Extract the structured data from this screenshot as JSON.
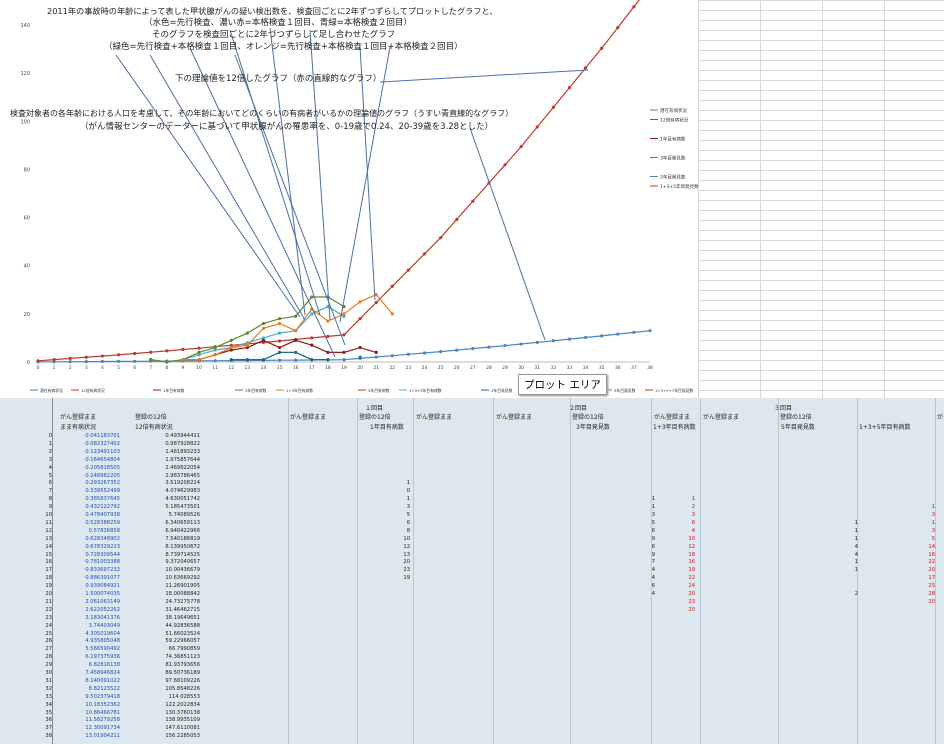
{
  "annotations": {
    "line1": "2011年の事故時の年齢によって表した甲状腺がんの疑い検出数を、検査回ごとに2年ずつずらしてプロットしたグラフと、",
    "line2": "（水色=先行検査、濃い赤=本格検査１回目、青緑=本格検査２回目）",
    "line3": "そのグラフを検査回ごとに2年づつずらして足し合わせたグラフ",
    "line4": "（緑色=先行検査+本格検査１回目、オレンジ=先行検査+本格検査１回目+本格検査２回目）",
    "line5": "下の理論値を12倍したグラフ（赤の直線的なグラフ）",
    "line6": "検査対象者の各年齢における人口を考慮して、その年齢においてどのくらいの有病者がいるかの理論値のグラフ（うすい青直線的なグラフ）",
    "line7": "（がん情報センターのデーターに基づいて甲状腺がんの罹患率を、0-19歳で0.24、20-39歳を3.28とした）"
  },
  "tooltip": "プロット エリア",
  "legend_right": [
    "潜在有病状況",
    "12倍有病状況",
    "",
    "1年目有病数",
    "",
    "3年目発見数",
    "",
    "5年目発見数",
    "1+3+5年目発見数"
  ],
  "legend_bottom": [
    "潜在有病状況",
    "12倍有病状況",
    "",
    "1年目有病数",
    "",
    "3年目有病数",
    "1+3年目有病数",
    "",
    "5年目有病数",
    "1+3+5年目有病数",
    "",
    "3年目発見数",
    "1+3+5+7年目発見数",
    "",
    "5年目発見数",
    "1+3+5+7年目発見数"
  ],
  "sheet": {
    "h1": "１回目",
    "h2": "２回目",
    "h3": "３回目",
    "c_a": "がん登録まま",
    "c_b": "登録の12倍",
    "c_a2": "まま有病状況",
    "c_b2": "12倍有病状況",
    "g1a": "がん登録まま",
    "g1b": "登録の12倍",
    "g1c": "がん登録まま",
    "g1sub": "1年目有病数",
    "g2a": "がん登録まま",
    "g2b": "登録の12倍",
    "g2c": "がん登録まま",
    "g2sub": "3年目発見数",
    "g2sub2": "1+3年目有病数",
    "g3a": "がん登録まま",
    "g3b": "登録の12倍",
    "g3sub": "5年目発見数",
    "g3sub2": "1+3+5年目有病数",
    "g4a": "が"
  },
  "colors": {
    "red_theory": "#c0392b",
    "blue_theory": "#4a86c5",
    "lightblue": "#4bacc6",
    "darkred": "#8b1a1a",
    "teal": "#1f6e7c",
    "green": "#5a8a2a",
    "orange": "#e67e22",
    "arrow": "#4a6fa5"
  },
  "chart_data": {
    "type": "line",
    "x": [
      0,
      1,
      2,
      3,
      4,
      5,
      6,
      7,
      8,
      9,
      10,
      11,
      12,
      13,
      14,
      15,
      16,
      17,
      18,
      19,
      20,
      21,
      22,
      23,
      24,
      25,
      26,
      27,
      28,
      29,
      30,
      31,
      32,
      33,
      34,
      35,
      36,
      37,
      38
    ],
    "ylim": [
      0,
      150
    ],
    "yticks": [
      0,
      20,
      40,
      60,
      80,
      100,
      120,
      140
    ],
    "series": [
      {
        "name": "潜在有病状況",
        "color": "#4a86c5",
        "values": [
          0.04,
          0.08,
          0.12,
          0.16,
          0.21,
          0.25,
          0.29,
          0.34,
          0.39,
          0.43,
          0.48,
          0.53,
          0.58,
          0.63,
          0.68,
          0.73,
          0.78,
          0.83,
          0.89,
          0.94,
          1.5,
          2.06,
          2.62,
          3.18,
          3.74,
          4.31,
          4.94,
          5.57,
          6.2,
          6.83,
          7.46,
          8.14,
          8.82,
          9.5,
          10.18,
          10.86,
          11.59,
          12.3,
          13.02
        ]
      },
      {
        "name": "12倍有病状況",
        "color": "#c0392b",
        "values": [
          0.49,
          0.99,
          1.48,
          1.98,
          2.47,
          2.99,
          3.52,
          4.07,
          4.63,
          5.19,
          5.74,
          6.34,
          6.94,
          7.54,
          8.14,
          8.74,
          9.37,
          10.0,
          10.64,
          11.27,
          18.0,
          24.73,
          31.46,
          38.2,
          44.93,
          51.66,
          59.23,
          66.8,
          74.37,
          81.94,
          89.51,
          97.68,
          105.85,
          114.03,
          122.2,
          130.38,
          138.95,
          147.61,
          156.23
        ]
      },
      {
        "name": "1年目有病数",
        "color": "#4bacc6",
        "values": [
          null,
          null,
          null,
          null,
          null,
          null,
          null,
          1,
          0,
          1,
          3,
          5,
          6,
          8,
          10,
          12,
          13,
          20,
          23,
          19
        ]
      },
      {
        "name": "3年目発見数",
        "color": "#8b1a1a",
        "values": [
          null,
          null,
          null,
          null,
          null,
          null,
          null,
          null,
          null,
          1,
          1,
          3,
          5,
          6,
          9,
          6,
          9,
          7,
          4,
          4,
          6,
          4
        ]
      },
      {
        "name": "5年目発見数",
        "color": "#1f6e7c",
        "values": [
          null,
          null,
          null,
          null,
          null,
          null,
          null,
          null,
          null,
          null,
          null,
          null,
          1,
          1,
          1,
          4,
          4,
          1,
          1,
          null,
          2
        ]
      },
      {
        "name": "1+3年目有病数",
        "color": "#5a8a2a",
        "values": [
          null,
          null,
          null,
          null,
          null,
          null,
          null,
          1,
          0,
          1,
          4,
          6,
          9,
          12,
          16,
          18,
          19,
          27,
          27,
          23
        ]
      },
      {
        "name": "1+3+5年目有病数",
        "color": "#e67e22",
        "values": [
          null,
          null,
          null,
          null,
          null,
          null,
          null,
          null,
          null,
          1,
          1,
          3,
          6,
          7,
          14,
          16,
          13,
          22,
          17,
          20,
          25,
          28,
          20
        ]
      }
    ]
  },
  "table": {
    "rows": [
      {
        "idx": "0",
        "c": "0.041183701",
        "d": "0.493944411"
      },
      {
        "idx": "1",
        "c": "0.082327402",
        "d": "0.987928822"
      },
      {
        "idx": "2",
        "c": "0.123491103",
        "d": "1.481893233"
      },
      {
        "idx": "3",
        "c": "0.164654804",
        "d": "1.975857644"
      },
      {
        "idx": "4",
        "c": "0.205818505",
        "d": "2.469822054"
      },
      {
        "idx": "5",
        "c": "0.248982205",
        "d": "2.983786465"
      },
      {
        "idx": "6",
        "c": "0.293267352",
        "d": "3.519208224"
      },
      {
        "idx": "7",
        "c": "0.339552499",
        "d": "4.074629983"
      },
      {
        "idx": "8",
        "c": "0.385837645",
        "d": "4.630051742"
      },
      {
        "idx": "9",
        "c": "0.432122792",
        "d": "5.185473501"
      },
      {
        "idx": "10",
        "c": "0.478407938",
        "d": "5.74089526"
      },
      {
        "idx": "11",
        "c": "0.528388259",
        "d": "6.340659113"
      },
      {
        "idx": "12",
        "c": "0.57836858",
        "d": "6.940422966"
      },
      {
        "idx": "13",
        "c": "0.628348902",
        "d": "7.540186819"
      },
      {
        "idx": "14",
        "c": "0.678329223",
        "d": "8.139950672"
      },
      {
        "idx": "15",
        "c": "0.728309544",
        "d": "8.739714525"
      },
      {
        "idx": "16",
        "c": "0.781003388",
        "d": "9.372040657"
      },
      {
        "idx": "17",
        "c": "0.833697232",
        "d": "10.00436679"
      },
      {
        "idx": "18",
        "c": "0.886391077",
        "d": "10.63669292"
      },
      {
        "idx": "19",
        "c": "0.939084921",
        "d": "11.26901905"
      },
      {
        "idx": "20",
        "c": "1.500074035",
        "d": "18.00088842"
      },
      {
        "idx": "21",
        "c": "2.061063149",
        "d": "24.73275778"
      },
      {
        "idx": "22",
        "c": "2.622052262",
        "d": "31.46462715"
      },
      {
        "idx": "23",
        "c": "3.183041376",
        "d": "38.19649651"
      },
      {
        "idx": "24",
        "c": "3.74403049",
        "d": "44.92836588"
      },
      {
        "idx": "25",
        "c": "4.305019604",
        "d": "51.66023524"
      },
      {
        "idx": "26",
        "c": "4.935805048",
        "d": "59.22966057"
      },
      {
        "idx": "27",
        "c": "5.566590492",
        "d": "66.7990859"
      },
      {
        "idx": "28",
        "c": "6.197375936",
        "d": "74.36851123"
      },
      {
        "idx": "29",
        "c": "6.82816138",
        "d": "81.93793656"
      },
      {
        "idx": "30",
        "c": "7.458946824",
        "d": "89.50736189"
      },
      {
        "idx": "31",
        "c": "8.140091022",
        "d": "97.68109226"
      },
      {
        "idx": "32",
        "c": "8.82123522",
        "d": "105.8548226"
      },
      {
        "idx": "33",
        "c": "9.502379418",
        "d": "114.028553"
      },
      {
        "idx": "34",
        "c": "10.18352362",
        "d": "122.2022834"
      },
      {
        "idx": "35",
        "c": "10.86466781",
        "d": "130.3760138"
      },
      {
        "idx": "36",
        "c": "11.58279258",
        "d": "138.9935109"
      },
      {
        "idx": "37",
        "c": "12.30091734",
        "d": "147.6110081"
      },
      {
        "idx": "38",
        "c": "13.01904211",
        "d": "156.2285053"
      }
    ],
    "g1": [
      null,
      null,
      null,
      null,
      null,
      null,
      "1",
      "0",
      "1",
      "3",
      "5",
      "6",
      "8",
      "10",
      "12",
      "13",
      "20",
      "23",
      "19"
    ],
    "g2x": [
      null,
      null,
      null,
      null,
      null,
      null,
      null,
      null,
      "1",
      "1",
      "3",
      "5",
      "6",
      "9",
      "6",
      "9",
      "7",
      "4",
      "4",
      "6",
      "4"
    ],
    "g2y": [
      null,
      null,
      null,
      null,
      null,
      null,
      null,
      null,
      "1",
      "2",
      "3",
      "6",
      "4",
      "10",
      "12",
      "18",
      "16",
      "19",
      "22",
      "24",
      "20",
      "23",
      "20"
    ],
    "g3x": [
      null,
      null,
      null,
      null,
      null,
      null,
      null,
      null,
      null,
      null,
      null,
      "1",
      "1",
      "1",
      "4",
      "4",
      "1",
      "1",
      null,
      null,
      "2"
    ],
    "g3y": [
      null,
      null,
      null,
      null,
      null,
      null,
      null,
      null,
      null,
      "1",
      "3",
      "1",
      "3",
      "5",
      "14",
      "16",
      "22",
      "20",
      "17",
      "25",
      "28",
      "20"
    ]
  }
}
